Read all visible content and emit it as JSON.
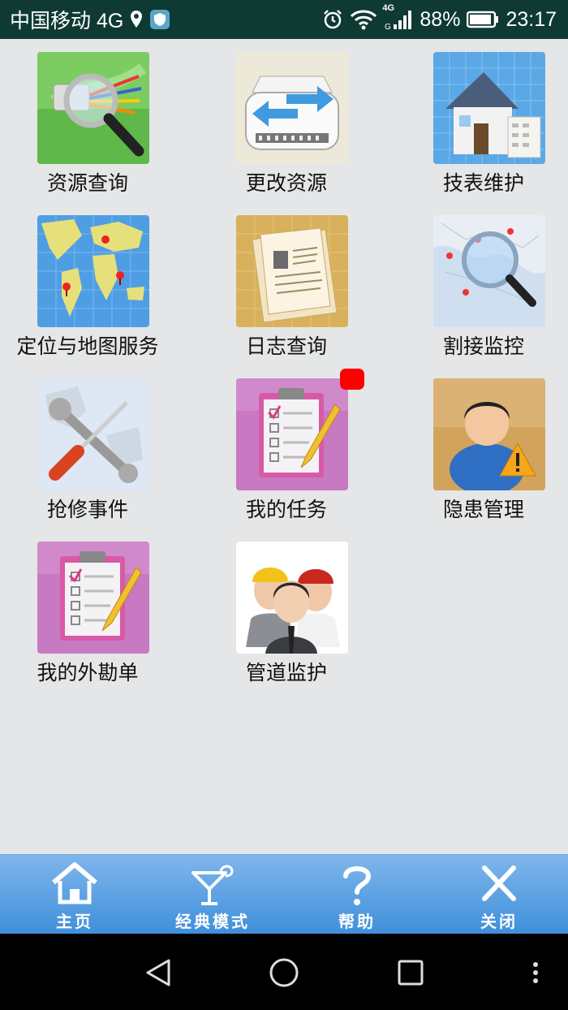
{
  "status_bar": {
    "carrier": "中国移动 4G",
    "network_label": "4G",
    "battery": "88%",
    "time": "23:17"
  },
  "grid": {
    "items": [
      {
        "label": "资源查询",
        "icon": "resource-search-icon"
      },
      {
        "label": "更改资源",
        "icon": "change-resource-icon"
      },
      {
        "label": "技表维护",
        "icon": "house-maintenance-icon"
      },
      {
        "label": "定位与地图服务",
        "icon": "world-map-icon"
      },
      {
        "label": "日志查询",
        "icon": "log-folder-icon"
      },
      {
        "label": "割接监控",
        "icon": "map-magnifier-icon"
      },
      {
        "label": "抢修事件",
        "icon": "repair-tools-icon"
      },
      {
        "label": "我的任务",
        "icon": "clipboard-icon",
        "badge": true
      },
      {
        "label": "隐患管理",
        "icon": "user-warning-icon"
      },
      {
        "label": "我的外勘单",
        "icon": "clipboard-icon"
      },
      {
        "label": "管道监护",
        "icon": "workers-icon"
      }
    ]
  },
  "toolbar": {
    "items": [
      {
        "label": "主页",
        "icon": "home-icon"
      },
      {
        "label": "经典模式",
        "icon": "cocktail-icon"
      },
      {
        "label": "帮助",
        "icon": "question-icon"
      },
      {
        "label": "关闭",
        "icon": "close-icon"
      }
    ]
  },
  "colors": {
    "status_bar_bg": "#0e3a33",
    "page_bg": "#e4e6e7",
    "toolbar_top": "#7fb6ec",
    "toolbar_bottom": "#3f8fdb",
    "badge": "#ff0000",
    "nav_bar_bg": "#000000"
  }
}
